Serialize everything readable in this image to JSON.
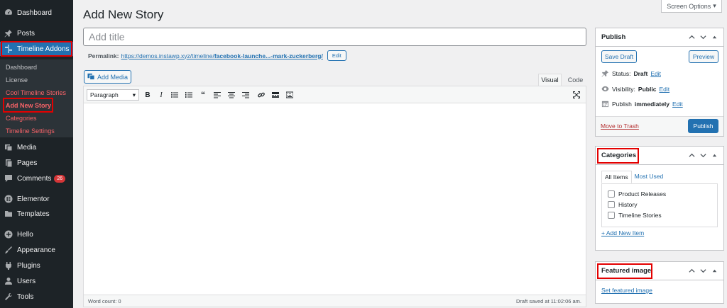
{
  "sidebar": {
    "items": [
      {
        "label": "Dashboard",
        "icon": "dashboard-icon"
      },
      {
        "label": "Posts",
        "icon": "pin-icon"
      },
      {
        "label": "Timeline Addons",
        "icon": "timeline-icon"
      },
      {
        "label": "Media",
        "icon": "media-icon"
      },
      {
        "label": "Pages",
        "icon": "pages-icon"
      },
      {
        "label": "Comments",
        "icon": "comments-icon",
        "badge": "26"
      },
      {
        "label": "Elementor",
        "icon": "elementor-icon"
      },
      {
        "label": "Templates",
        "icon": "folder-icon"
      },
      {
        "label": "Hello",
        "icon": "plus-circle-icon"
      },
      {
        "label": "Appearance",
        "icon": "brush-icon"
      },
      {
        "label": "Plugins",
        "icon": "plug-icon"
      },
      {
        "label": "Users",
        "icon": "users-icon"
      },
      {
        "label": "Tools",
        "icon": "wrench-icon"
      }
    ],
    "submenu": [
      {
        "label": "Dashboard"
      },
      {
        "label": "License"
      },
      {
        "label": "Cool Timeline Stories"
      },
      {
        "label": "Add New Story"
      },
      {
        "label": "Categories"
      },
      {
        "label": "Timeline Settings"
      }
    ]
  },
  "header": {
    "title": "Add New Story",
    "screen_options": "Screen Options"
  },
  "editor": {
    "title_placeholder": "Add title",
    "permalink_label": "Permalink:",
    "permalink_base": "https://demos.instawp.xyz/timeline/",
    "permalink_slug": "facebook-launche...-mark-zuckerberg/",
    "edit_label": "Edit",
    "add_media": "Add Media",
    "tab_visual": "Visual",
    "tab_code": "Code",
    "format_select": "Paragraph",
    "word_count": "Word count: 0",
    "draft_saved": "Draft saved at 11:02:06 am."
  },
  "publish": {
    "title": "Publish",
    "save_draft": "Save Draft",
    "preview": "Preview",
    "status_label": "Status:",
    "status_value": "Draft",
    "visibility_label": "Visibility:",
    "visibility_value": "Public",
    "publish_label": "Publish",
    "publish_value": "immediately",
    "edit": "Edit",
    "move_to_trash": "Move to Trash",
    "publish_button": "Publish"
  },
  "categories": {
    "title": "Categories",
    "tab_all": "All Items",
    "tab_most_used": "Most Used",
    "items": [
      "Product Releases",
      "History",
      "Timeline Stories"
    ],
    "add_new": "+ Add New Item"
  },
  "featured_image": {
    "title": "Featured image",
    "set_link": "Set featured image"
  },
  "colors": {
    "admin_bg": "#1d2327",
    "accent": "#2271b1",
    "highlight": "#e30000"
  }
}
